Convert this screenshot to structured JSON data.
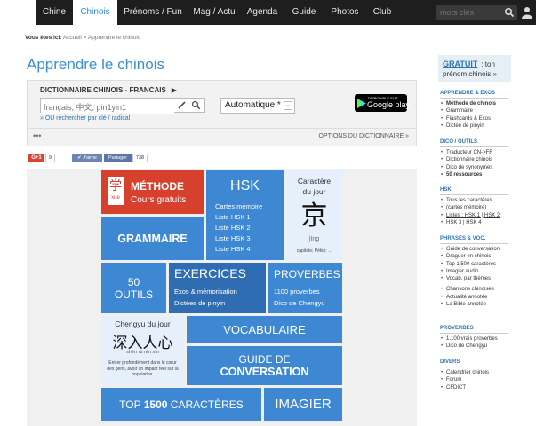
{
  "nav": {
    "items": [
      "Chine",
      "Chinois",
      "Prénoms / Fun",
      "Mag / Actu",
      "Agenda",
      "Guide",
      "Photos",
      "Club"
    ],
    "active": "Chinois",
    "search_placeholder": "mots clés"
  },
  "breadcrumb": {
    "prefix": "Vous êtes ici:",
    "path": "Accueil > Apprendre le chinois"
  },
  "page_title": "Apprendre le chinois",
  "dictionary": {
    "title": "DICTIONNAIRE CHINOIS - FRANCAIS",
    "arrow": "▶",
    "input_placeholder": "français, 中文, pin1yin1",
    "search_link": "» OU rechercher par clé / radical",
    "select_value": "Automatique *",
    "google_play_small": "DISPONIBLE SUR",
    "google_play_big": "Google play",
    "dots": "•••",
    "options": "OPTIONS DU DICTIONNAIRE »"
  },
  "social": {
    "gplus_label": "G+1",
    "gplus_count": "9",
    "like_label": "✔ J'aime",
    "share_label": "Partager",
    "share_count": "738"
  },
  "tiles": {
    "methode": {
      "icon_char": "学",
      "icon_sub": "xue",
      "title": "MÉTHODE",
      "sub": "Cours gratuits"
    },
    "hsk": {
      "title": "HSK",
      "items": [
        "Cartes mémoire",
        "Liste HSK 1",
        "Liste HSK 2",
        "Liste HSK 3",
        "Liste HSK 4"
      ]
    },
    "caractere": {
      "title1": "Caractère",
      "title2": "du jour",
      "char": "京",
      "pinyin": "jīng",
      "meaning": "capitale; Pékin; ..."
    },
    "grammaire": {
      "title": "GRAMMAIRE"
    },
    "outils": {
      "num": "50",
      "label": "OUTILS"
    },
    "exercices": {
      "title": "EXERCICES",
      "sub1": "Exos & mémorisation",
      "sub2": "Dictées de pinyin"
    },
    "proverbes": {
      "title": "PROVERBES",
      "sub1": "1100 proverbes",
      "sub2": "Dico de Chengyu"
    },
    "chengyu": {
      "title": "Chengyu du jour",
      "chars": "深入人心",
      "pinyin": "shēn rù rén xīn",
      "desc": "Entrer profondément dans le cœur des gens, avoir un impact réel sur la population."
    },
    "vocabulaire": {
      "title": "VOCABULAIRE"
    },
    "guide": {
      "line1": "GUIDE DE",
      "line2": "CONVERSATION"
    },
    "top": {
      "pre": "TOP ",
      "num": "1500",
      "post": " CARACTÈRES"
    },
    "imagier": {
      "title": "IMAGIER"
    }
  },
  "sidebar": {
    "promo_link": "GRATUIT",
    "promo_text1": ": ton",
    "promo_text2": "prénom chinois »",
    "sections": [
      {
        "title": "APPRENDRE & EXOS",
        "items": [
          "Méthode de chinois",
          "Grammaire",
          "Flashcards & Exos",
          "Dictée de pinyin"
        ]
      },
      {
        "title": "DICO / OUTILS",
        "items": [
          "Traducteur CN->FR",
          "Dictionnaire chinois",
          "Dico de synonymes",
          "50 ressources"
        ]
      },
      {
        "title": "HSK",
        "items": [
          "Tous les caractères",
          "(cartes mémoire)",
          "Listes : HSK 1 | HSK 2",
          "HSK 3 | HSK 4"
        ]
      },
      {
        "title": "PHRASES & VOC.",
        "items": [
          "Guide de conversation",
          "Draguer en chinois",
          "Top 1.500 caractères",
          "Imagier audio",
          "Vocab. par thèmes",
          "",
          "Chansons chinoises",
          "Actualité annotée",
          "La Bible annotée"
        ]
      },
      {
        "title": "PROVERBES",
        "items": [
          "1.100 vrais proverbes",
          "Dico de Chengyu"
        ]
      },
      {
        "title": "DIVERS",
        "items": [
          "Calendrier chinois",
          "Forum",
          "CFDICT"
        ]
      }
    ]
  },
  "colors": {
    "accent": "#3d87d3",
    "red": "#d8402e",
    "navbar": "#1e1e1e"
  }
}
